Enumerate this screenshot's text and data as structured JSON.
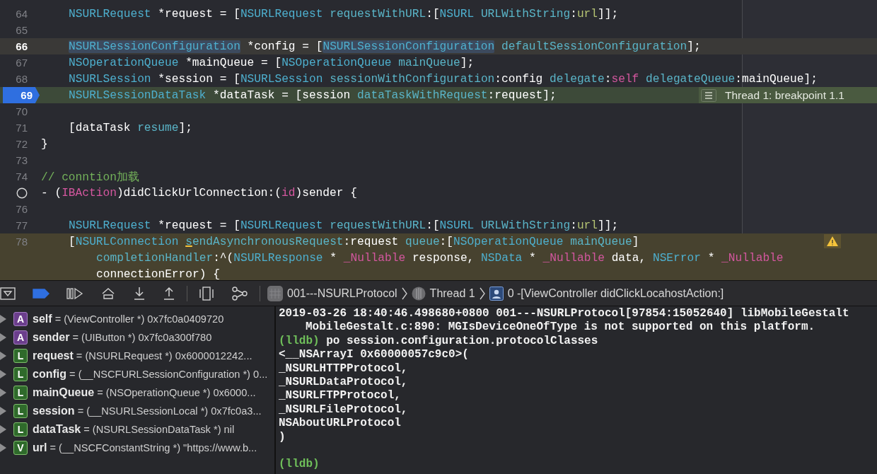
{
  "editor": {
    "lines": [
      {
        "num": "64",
        "kind": "body",
        "tokens": [
          {
            "t": "NSURLRequest",
            "kind": "type"
          },
          {
            "t": " *request = [",
            "kind": "plain"
          },
          {
            "t": "NSURLRequest",
            "kind": "type"
          },
          {
            "t": " requestWithURL",
            "kind": "method"
          },
          {
            "t": ":[",
            "kind": "plain"
          },
          {
            "t": "NSURL",
            "kind": "type"
          },
          {
            "t": " URLWithString",
            "kind": "method"
          },
          {
            "t": ":",
            "kind": "plain"
          },
          {
            "t": "url",
            "kind": "var"
          },
          {
            "t": "]];",
            "kind": "plain"
          }
        ]
      },
      {
        "num": "65"
      },
      {
        "num": "66",
        "kind": "body",
        "current": true,
        "tokens": [
          {
            "t": "NSURLSessionConfiguration",
            "kind": "type",
            "found": true
          },
          {
            "t": " *config = [",
            "kind": "plain"
          },
          {
            "t": "NSURLSessionConfiguration",
            "kind": "type",
            "found": true
          },
          {
            "t": " defaultSessionConfiguration",
            "kind": "method"
          },
          {
            "t": "];",
            "kind": "plain"
          }
        ]
      },
      {
        "num": "67",
        "kind": "body",
        "tokens": [
          {
            "t": "NSOperationQueue",
            "kind": "type"
          },
          {
            "t": " *mainQueue = [",
            "kind": "plain"
          },
          {
            "t": "NSOperationQueue",
            "kind": "type"
          },
          {
            "t": " mainQueue",
            "kind": "method"
          },
          {
            "t": "];",
            "kind": "plain"
          }
        ]
      },
      {
        "num": "68",
        "kind": "body",
        "tokens": [
          {
            "t": "NSURLSession",
            "kind": "type"
          },
          {
            "t": " *session = [",
            "kind": "plain"
          },
          {
            "t": "NSURLSession",
            "kind": "type"
          },
          {
            "t": " sessionWithConfiguration",
            "kind": "method"
          },
          {
            "t": ":config",
            "kind": "plain"
          },
          {
            "t": " delegate",
            "kind": "method"
          },
          {
            "t": ":",
            "kind": "plain"
          },
          {
            "t": "self",
            "kind": "keyword"
          },
          {
            "t": " delegateQueue",
            "kind": "method"
          },
          {
            "t": ":mainQueue];",
            "kind": "plain"
          }
        ]
      },
      {
        "num": "69",
        "kind": "body",
        "breakpoint": true,
        "annotation": "Thread 1: breakpoint 1.1",
        "tokens": [
          {
            "t": "NSURLSessionDataTask",
            "kind": "type"
          },
          {
            "t": " *dataTask = [session",
            "kind": "plain"
          },
          {
            "t": " dataTaskWithRequest",
            "kind": "method"
          },
          {
            "t": ":request];",
            "kind": "plain"
          }
        ]
      },
      {
        "num": "70"
      },
      {
        "num": "71",
        "kind": "body",
        "tokens": [
          {
            "t": "[dataTask",
            "kind": "plain"
          },
          {
            "t": " resume",
            "kind": "method"
          },
          {
            "t": "];",
            "kind": "plain"
          }
        ]
      },
      {
        "num": "72",
        "kind": "top",
        "tokens": [
          {
            "t": "}",
            "kind": "plain"
          }
        ]
      },
      {
        "num": "73"
      },
      {
        "num": "74",
        "kind": "top",
        "tokens": [
          {
            "t": "// conntion加载",
            "kind": "comment"
          }
        ]
      },
      {
        "kind": "top",
        "action_circle": true,
        "tokens": [
          {
            "t": "- (",
            "kind": "plain"
          },
          {
            "t": "IBAction",
            "kind": "keyword"
          },
          {
            "t": ")didClickUrlConnection:(",
            "kind": "plain"
          },
          {
            "t": "id",
            "kind": "keyword"
          },
          {
            "t": ")sender {",
            "kind": "plain"
          }
        ]
      },
      {
        "num": "76"
      },
      {
        "num": "77",
        "kind": "body",
        "tokens": [
          {
            "t": "NSURLRequest",
            "kind": "type"
          },
          {
            "t": " *request = [",
            "kind": "plain"
          },
          {
            "t": "NSURLRequest",
            "kind": "type"
          },
          {
            "t": " requestWithURL",
            "kind": "method"
          },
          {
            "t": ":[",
            "kind": "plain"
          },
          {
            "t": "NSURL",
            "kind": "type"
          },
          {
            "t": " URLWithString",
            "kind": "method"
          },
          {
            "t": ":",
            "kind": "plain"
          },
          {
            "t": "url",
            "kind": "var"
          },
          {
            "t": "]];",
            "kind": "plain"
          }
        ]
      },
      {
        "num": "78",
        "kind": "body",
        "warning": true,
        "warning_icon": true,
        "tokens": [
          {
            "t": "[",
            "kind": "plain"
          },
          {
            "t": "NSURLConnection ",
            "kind": "type"
          },
          {
            "t": "s",
            "kind": "method",
            "flag": true
          },
          {
            "t": "endAsynchronousRequest",
            "kind": "method"
          },
          {
            "t": ":request",
            "kind": "plain"
          },
          {
            "t": " queue",
            "kind": "method"
          },
          {
            "t": ":[",
            "kind": "plain"
          },
          {
            "t": "NSOperationQueue",
            "kind": "type"
          },
          {
            "t": " mainQueue",
            "kind": "method"
          },
          {
            "t": "]",
            "kind": "plain"
          }
        ]
      },
      {
        "kind": "continuation",
        "warning": true,
        "tokens": [
          {
            "t": "completionHandler",
            "kind": "method"
          },
          {
            "t": ":^(",
            "kind": "plain"
          },
          {
            "t": "NSURLResponse",
            "kind": "type"
          },
          {
            "t": " * ",
            "kind": "plain"
          },
          {
            "t": "_Nullable",
            "kind": "keyword"
          },
          {
            "t": " response, ",
            "kind": "plain"
          },
          {
            "t": "NSData",
            "kind": "type"
          },
          {
            "t": " * ",
            "kind": "plain"
          },
          {
            "t": "_Nullable",
            "kind": "keyword"
          },
          {
            "t": " data, ",
            "kind": "plain"
          },
          {
            "t": "NSError",
            "kind": "type"
          },
          {
            "t": " * ",
            "kind": "plain"
          },
          {
            "t": "_Nullable",
            "kind": "keyword"
          }
        ]
      },
      {
        "kind": "continuation",
        "warning": true,
        "tokens": [
          {
            "t": "connectionError) {",
            "kind": "plain"
          }
        ]
      }
    ]
  },
  "debug_bar": {
    "breakpoints_active": true,
    "breadcrumb": [
      {
        "kind": "app",
        "label": "001---NSURLProtocol"
      },
      {
        "kind": "thread",
        "label": "Thread 1"
      },
      {
        "kind": "frame",
        "label": "0 -[ViewController didClickLocahostAction:]"
      }
    ]
  },
  "variables": [
    {
      "badge": "A",
      "kind": "argument",
      "name": "self",
      "value": "= (ViewController *) 0x7fc0a0409720"
    },
    {
      "badge": "A",
      "kind": "argument",
      "name": "sender",
      "value": "= (UIButton *) 0x7fc0a300f780"
    },
    {
      "badge": "L",
      "kind": "local",
      "name": "request",
      "value": "= (NSURLRequest *) 0x6000012242..."
    },
    {
      "badge": "L",
      "kind": "local",
      "name": "config",
      "value": "= (__NSCFURLSessionConfiguration *) 0..."
    },
    {
      "badge": "L",
      "kind": "local",
      "name": "mainQueue",
      "value": "= (NSOperationQueue *) 0x6000..."
    },
    {
      "badge": "L",
      "kind": "local",
      "name": "session",
      "value": "= (__NSURLSessionLocal *) 0x7fc0a3..."
    },
    {
      "badge": "L",
      "kind": "local",
      "name": "dataTask",
      "value": "= (NSURLSessionDataTask *) nil"
    },
    {
      "badge": "V",
      "kind": "variable",
      "name": "url",
      "value": "= (__NSCFConstantString *) \"https://www.b..."
    }
  ],
  "console": [
    {
      "text": "2019-03-26 18:40:46.498680+0800 001---NSURLProtocol[97854:15052640] libMobileGestalt"
    },
    {
      "text": "MobileGestalt.c:890: MGIsDeviceOneOfType is not supported on this platform.",
      "indent": true
    },
    {
      "prompt": "(lldb)",
      "text": "po session.configuration.protocolClasses"
    },
    {
      "text": "<__NSArrayI 0x60000057c9c0>("
    },
    {
      "text": "_NSURLHTTPProtocol,"
    },
    {
      "text": "_NSURLDataProtocol,"
    },
    {
      "text": "_NSURLFTPProtocol,"
    },
    {
      "text": "_NSURLFileProtocol,"
    },
    {
      "text": "NSAboutURLProtocol"
    },
    {
      "text": ")"
    },
    {
      "prompt": "(lldb)",
      "spaced": true
    }
  ]
}
